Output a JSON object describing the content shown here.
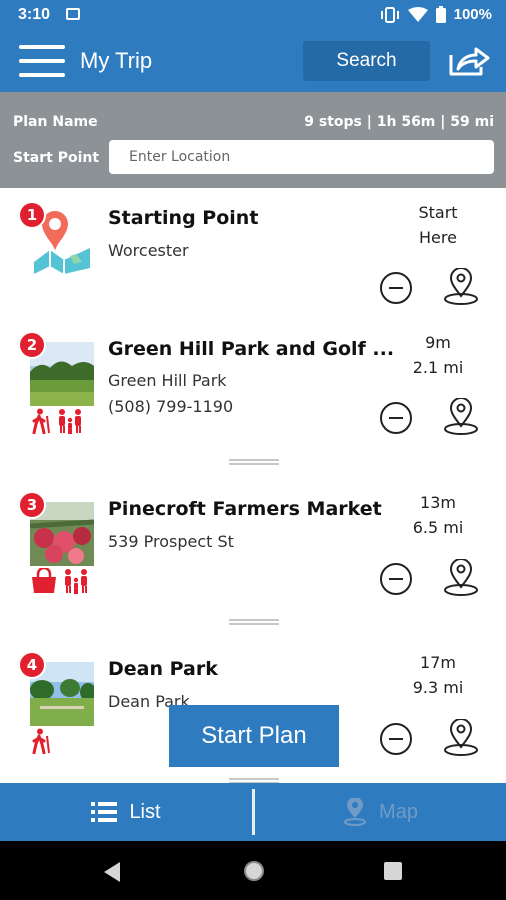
{
  "status": {
    "time": "3:10",
    "battery": "100%"
  },
  "header": {
    "title": "My Trip",
    "search_label": "Search"
  },
  "plan": {
    "name_label": "Plan Name",
    "stats": "9 stops | 1h 56m | 59 mi",
    "start_label": "Start Point",
    "start_placeholder": "Enter Location"
  },
  "stops": [
    {
      "number": "1",
      "name": "Starting Point",
      "line1": "Worcester",
      "line2": "",
      "time_top": "Start",
      "time_bottom": "Here"
    },
    {
      "number": "2",
      "name": "Green Hill Park and Golf ...",
      "line1": "Green Hill Park",
      "line2": "(508) 799-1190",
      "time_top": "9m",
      "time_bottom": "2.1 mi"
    },
    {
      "number": "3",
      "name": "Pinecroft Farmers Market",
      "line1": "539 Prospect St",
      "line2": "",
      "time_top": "13m",
      "time_bottom": "6.5 mi"
    },
    {
      "number": "4",
      "name": "Dean Park",
      "line1": "Dean Park",
      "line2": "",
      "time_top": "17m",
      "time_bottom": "9.3 mi"
    }
  ],
  "start_plan_label": "Start Plan",
  "tabs": {
    "list_label": "List",
    "map_label": "Map"
  },
  "colors": {
    "primary": "#2f7bbf",
    "badge": "#e0202e",
    "gray_bar": "#8d9296"
  }
}
